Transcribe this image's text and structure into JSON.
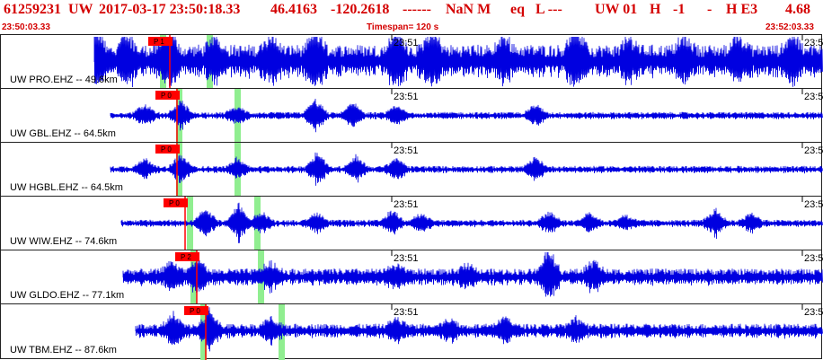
{
  "header": {
    "event_id": "61259231",
    "network": "UW",
    "datetime": "2017-03-17 23:50:18.33",
    "lat": "46.4163",
    "lon": "-120.2618",
    "dashes": "------",
    "magnitude": "NaN M",
    "etype": "eq",
    "quality": "L ---",
    "net_code": "UW 01",
    "h1": "H",
    "h2": "-1",
    "h3": "-",
    "h4": "H E3",
    "value": "4.68",
    "dashes2": "-----"
  },
  "subheader": {
    "start_time": "23:50:03.33",
    "timespan": "Timespan= 120 s",
    "end_time": "23:52:03.33"
  },
  "colors": {
    "header_text": "#d40000",
    "trace": "#0000e0",
    "pick_box": "#ff0000",
    "pick_line": "#ff0000",
    "highlight": "#90ee90",
    "border": "#222222"
  },
  "panels": [
    {
      "channel": "UW PRO.EHZ -- 49.6km",
      "time_label": "23:51",
      "pick_label": "P 1",
      "right_label": "23:5"
    },
    {
      "channel": "UW GBL.EHZ -- 64.5km",
      "time_label": "23:51",
      "pick_label": "P 0",
      "right_label": "23:5"
    },
    {
      "channel": "UW HGBL.EHZ -- 64.5km",
      "time_label": "23:51",
      "pick_label": "P 0",
      "right_label": "23:5"
    },
    {
      "channel": "UW WIW.EHZ -- 74.6km",
      "time_label": "23:51",
      "pick_label": "P 0",
      "right_label": "23:5"
    },
    {
      "channel": "UW GLDO.EHZ -- 77.1km",
      "time_label": "23:51",
      "pick_label": "P 2",
      "right_label": "23:5"
    },
    {
      "channel": "UW TBM.EHZ -- 87.6km",
      "time_label": "23:51",
      "pick_label": "P 0",
      "right_label": "23:5"
    }
  ]
}
